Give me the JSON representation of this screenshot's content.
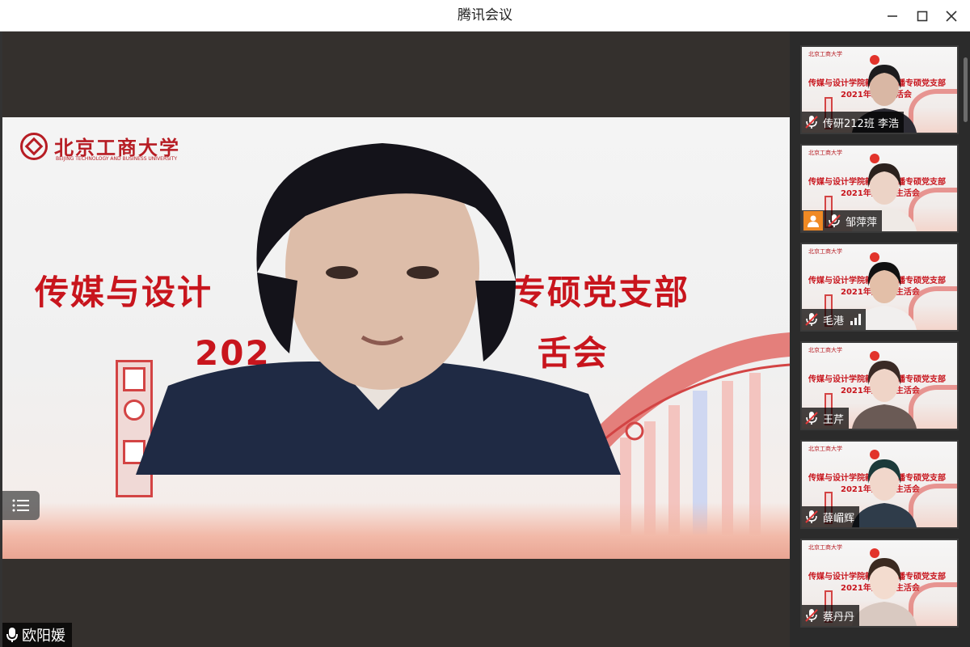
{
  "window": {
    "title": "腾讯会议"
  },
  "main": {
    "speaker_name": "欧阳媛",
    "slide": {
      "school_name": "北京工商大学",
      "school_name_en": "BEIJING TECHNOLOGY AND BUSINESS UNIVERSITY",
      "title_line1_left": "传媒与设计",
      "title_line1_right": "专硕党支部",
      "title_line2_left": "202",
      "title_line2_right": "舌会"
    }
  },
  "participants": [
    {
      "name": "传研212班 李浩",
      "slide_line1": "传媒与设计学院新闻与传播专硕党支部",
      "slide_line2": "2021年组织生活会",
      "badge": "mic-off",
      "hair": "#1c1b1d",
      "skin": "#d9b7a4",
      "shirt": "#2d2c34"
    },
    {
      "name": "邹萍萍",
      "slide_line1": "传媒与设计学院新闻与传播专硕党支部",
      "slide_line2": "2021年度组织生活会",
      "badge": "avatar-mic-off",
      "hair": "#2b211d",
      "skin": "#ecd3c6",
      "shirt": "#efeae6"
    },
    {
      "name": "毛港",
      "slide_line1": "传媒与设计学院新闻与传播专硕党支部",
      "slide_line2": "2021年度组织生活会",
      "badge": "mic-off-signal",
      "hair": "#111111",
      "skin": "#e3bfa8",
      "shirt": "#f1efee"
    },
    {
      "name": "王芹",
      "slide_line1": "传媒与设计学院新闻与传播专硕党支部",
      "slide_line2": "2021年度组织生活会",
      "badge": "mic-off",
      "hair": "#3a2a25",
      "skin": "#efd4c7",
      "shirt": "#6a5a55"
    },
    {
      "name": "薛嵋辉",
      "slide_line1": "传媒与设计学院新闻与传播专硕党支部",
      "slide_line2": "2021年度组织生活会",
      "badge": "mic-off",
      "hair": "#1c3a3a",
      "skin": "#f1d7cb",
      "shirt": "#2f3c4a"
    },
    {
      "name": "蔡丹丹",
      "slide_line1": "传媒与设计学院新闻与传播专硕党支部",
      "slide_line2": "2021年度组织生活会",
      "badge": "mic-off",
      "hair": "#3b2a21",
      "skin": "#f3dccf",
      "shirt": "#d9c9c1"
    }
  ],
  "colors": {
    "brand_red": "#c8151d",
    "accent_orange": "#f08a24",
    "sidebar_bg": "#2b2b2b"
  }
}
